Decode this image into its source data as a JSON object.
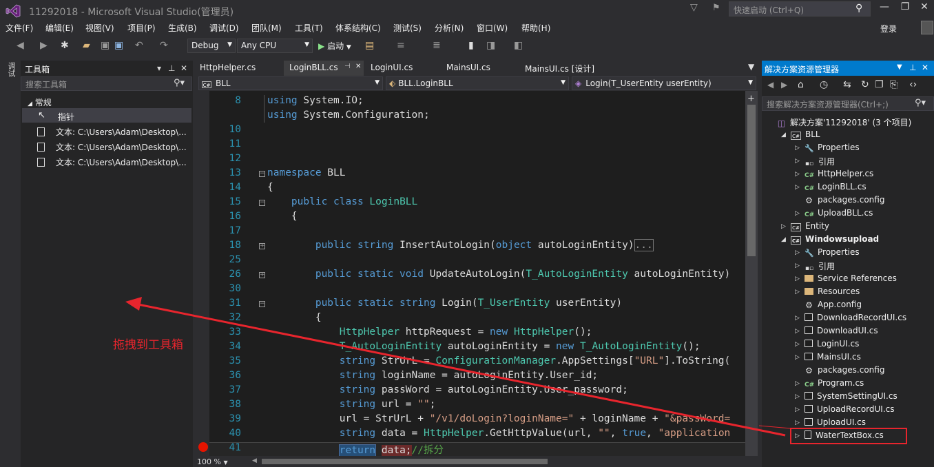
{
  "window": {
    "title": "11292018 - Microsoft Visual Studio(管理员)",
    "quick_launch_placeholder": "快速启动 (Ctrl+Q)",
    "signin": "登录"
  },
  "menu": [
    "文件(F)",
    "编辑(E)",
    "视图(V)",
    "项目(P)",
    "生成(B)",
    "调试(D)",
    "团队(M)",
    "工具(T)",
    "体系结构(C)",
    "测试(S)",
    "分析(N)",
    "窗口(W)",
    "帮助(H)"
  ],
  "toolbar": {
    "config": "Debug",
    "platform": "Any CPU",
    "start": "▶ 启动"
  },
  "side_strip": {
    "label": "调试"
  },
  "toolbox": {
    "title": "工具箱",
    "search_placeholder": "搜索工具箱",
    "group": "常规",
    "pointer": "指针",
    "items": [
      "文本: C:\\Users\\Adam\\Desktop\\...",
      "文本: C:\\Users\\Adam\\Desktop\\...",
      "文本: C:\\Users\\Adam\\Desktop\\..."
    ]
  },
  "annotation": {
    "text": "拖拽到工具箱"
  },
  "tabs": [
    "HttpHelper.cs",
    "LoginBLL.cs",
    "LoginUI.cs",
    "MainsUI.cs",
    "MainsUI.cs [设计]"
  ],
  "active_tab_index": 1,
  "nav": {
    "project": "BLL",
    "class": "BLL.LoginBLL",
    "member": "Login(T_UserEntity userEntity)"
  },
  "code": {
    "line_numbers": [
      "8",
      "10",
      "11",
      "12",
      "13",
      "14",
      "15",
      "16",
      "17",
      "18",
      "25",
      "26",
      "30",
      "31",
      "32",
      "33",
      "34",
      "35",
      "36",
      "37",
      "38",
      "39",
      "40",
      "41"
    ],
    "lines": [
      "using System.IO;",
      "using System.Configuration;",
      "",
      "",
      "",
      "namespace BLL",
      "{",
      "    public class LoginBLL",
      "    {",
      "",
      "        public string InsertAutoLogin(object autoLoginEntity)...",
      "",
      "        public static void UpdateAutoLogin(T_AutoLoginEntity autoLoginEntity)",
      "",
      "        public static string Login(T_UserEntity userEntity)",
      "        {",
      "            HttpHelper httpRequest = new HttpHelper();",
      "            T_AutoLoginEntity autoLoginEntity = new T_AutoLoginEntity();",
      "            string StrUrL = ConfigurationManager.AppSettings[\"URL\"].ToString(",
      "            string loginName = autoLoginEntity.User_id;",
      "            string passWord = autoLoginEntity.User_password;",
      "            string url = \"\";",
      "            url = StrUrL + \"/v1/doLogin?loginName=\" + loginName + \"&passWord=",
      "            string data = HttpHelper.GetHttpValue(url, \"\", true, \"application",
      "            return data;//拆分"
    ],
    "zoom": "100 %"
  },
  "solution_explorer": {
    "title": "解决方案资源管理器",
    "search_placeholder": "搜索解决方案资源管理器(Ctrl+;)",
    "nodes": [
      {
        "text": "解决方案'11292018' (3 个项目)",
        "icon": "solution-icon"
      },
      {
        "text": "BLL",
        "icon": "csproj-icon"
      },
      {
        "text": "Properties",
        "icon": "wrench-icon"
      },
      {
        "text": "引用",
        "icon": "references-icon"
      },
      {
        "text": "HttpHelper.cs",
        "icon": "csharp-file-icon"
      },
      {
        "text": "LoginBLL.cs",
        "icon": "csharp-file-icon"
      },
      {
        "text": "packages.config",
        "icon": "config-file-icon"
      },
      {
        "text": "UploadBLL.cs",
        "icon": "csharp-file-icon"
      },
      {
        "text": "Entity",
        "icon": "csproj-icon"
      },
      {
        "text": "Windowsupload",
        "icon": "csproj-icon"
      },
      {
        "text": "Properties",
        "icon": "wrench-icon"
      },
      {
        "text": "引用",
        "icon": "references-icon"
      },
      {
        "text": "Service References",
        "icon": "folder-icon"
      },
      {
        "text": "Resources",
        "icon": "folder-icon"
      },
      {
        "text": "App.config",
        "icon": "config-file-icon"
      },
      {
        "text": "DownloadRecordUI.cs",
        "icon": "form-icon"
      },
      {
        "text": "DownloadUI.cs",
        "icon": "form-icon"
      },
      {
        "text": "LoginUI.cs",
        "icon": "form-icon"
      },
      {
        "text": "MainsUI.cs",
        "icon": "form-icon"
      },
      {
        "text": "packages.config",
        "icon": "config-file-icon"
      },
      {
        "text": "Program.cs",
        "icon": "csharp-file-icon"
      },
      {
        "text": "SystemSettingUI.cs",
        "icon": "form-icon"
      },
      {
        "text": "UploadRecordUI.cs",
        "icon": "form-icon"
      },
      {
        "text": "UploadUI.cs",
        "icon": "form-icon"
      },
      {
        "text": "WaterTextBox.cs",
        "icon": "file-icon"
      }
    ]
  },
  "colors": {
    "accent": "#007acc",
    "annotation": "#e8252d",
    "keyword": "#569cd6",
    "type": "#4ec9b0",
    "string": "#d69d85",
    "comment": "#57a64a",
    "linenum": "#2b91af"
  }
}
